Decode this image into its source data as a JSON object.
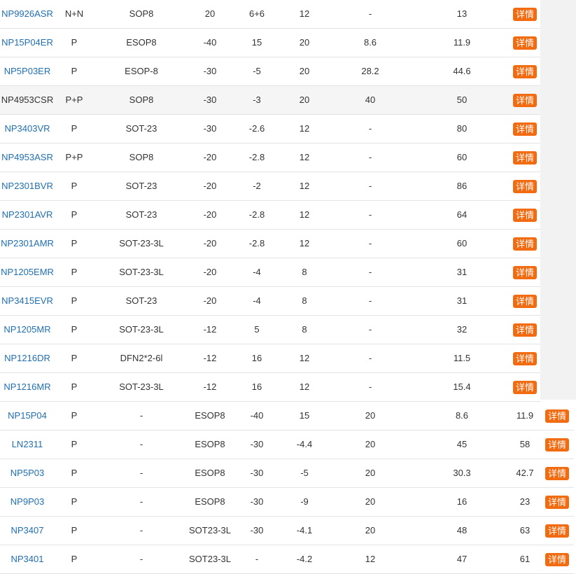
{
  "colors": {
    "accent": "#f26b10",
    "link": "#1f6fb2",
    "row_highlight": "#f5f5f5",
    "divider": "#e3e3e3"
  },
  "detail_label": "详情",
  "table_a": [
    {
      "model": "NP9926ASR",
      "polarity": "N+N",
      "package": "SOP8",
      "vds": "20",
      "id": "6+6",
      "vgs": "12",
      "rds10": "-",
      "rds45": "13",
      "link": true
    },
    {
      "model": "NP15P04ER",
      "polarity": "P",
      "package": "ESOP8",
      "vds": "-40",
      "id": "15",
      "vgs": "20",
      "rds10": "8.6",
      "rds45": "11.9",
      "link": true
    },
    {
      "model": "NP5P03ER",
      "polarity": "P",
      "package": "ESOP-8",
      "vds": "-30",
      "id": "-5",
      "vgs": "20",
      "rds10": "28.2",
      "rds45": "44.6",
      "link": true
    },
    {
      "model": "NP4953CSR",
      "polarity": "P+P",
      "package": "SOP8",
      "vds": "-30",
      "id": "-3",
      "vgs": "20",
      "rds10": "40",
      "rds45": "50",
      "link": false
    },
    {
      "model": "NP3403VR",
      "polarity": "P",
      "package": "SOT-23",
      "vds": "-30",
      "id": "-2.6",
      "vgs": "12",
      "rds10": "-",
      "rds45": "80",
      "link": true
    },
    {
      "model": "NP4953ASR",
      "polarity": "P+P",
      "package": "SOP8",
      "vds": "-20",
      "id": "-2.8",
      "vgs": "12",
      "rds10": "-",
      "rds45": "60",
      "link": true
    },
    {
      "model": "NP2301BVR",
      "polarity": "P",
      "package": "SOT-23",
      "vds": "-20",
      "id": "-2",
      "vgs": "12",
      "rds10": "-",
      "rds45": "86",
      "link": true
    },
    {
      "model": "NP2301AVR",
      "polarity": "P",
      "package": "SOT-23",
      "vds": "-20",
      "id": "-2.8",
      "vgs": "12",
      "rds10": "-",
      "rds45": "64",
      "link": true
    },
    {
      "model": "NP2301AMR",
      "polarity": "P",
      "package": "SOT-23-3L",
      "vds": "-20",
      "id": "-2.8",
      "vgs": "12",
      "rds10": "-",
      "rds45": "60",
      "link": true
    },
    {
      "model": "NP1205EMR",
      "polarity": "P",
      "package": "SOT-23-3L",
      "vds": "-20",
      "id": "-4",
      "vgs": "8",
      "rds10": "-",
      "rds45": "31",
      "link": true
    },
    {
      "model": "NP3415EVR",
      "polarity": "P",
      "package": "SOT-23",
      "vds": "-20",
      "id": "-4",
      "vgs": "8",
      "rds10": "-",
      "rds45": "31",
      "link": true
    },
    {
      "model": "NP1205MR",
      "polarity": "P",
      "package": "SOT-23-3L",
      "vds": "-12",
      "id": "5",
      "vgs": "8",
      "rds10": "-",
      "rds45": "32",
      "link": true
    },
    {
      "model": "NP1216DR",
      "polarity": "P",
      "package": "DFN2*2-6l",
      "vds": "-12",
      "id": "16",
      "vgs": "12",
      "rds10": "-",
      "rds45": "11.5",
      "link": true
    },
    {
      "model": "NP1216MR",
      "polarity": "P",
      "package": "SOT-23-3L",
      "vds": "-12",
      "id": "16",
      "vgs": "12",
      "rds10": "-",
      "rds45": "15.4",
      "link": true
    }
  ],
  "table_b": [
    {
      "model": "NP15P04",
      "polarity": "P",
      "col3": "-",
      "package": "ESOP8",
      "vds": "-40",
      "id": "15",
      "vgs": "20",
      "rds10": "8.6",
      "rds45": "11.9"
    },
    {
      "model": "LN2311",
      "polarity": "P",
      "col3": "-",
      "package": "ESOP8",
      "vds": "-30",
      "id": "-4.4",
      "vgs": "20",
      "rds10": "45",
      "rds45": "58"
    },
    {
      "model": "NP5P03",
      "polarity": "P",
      "col3": "-",
      "package": "ESOP8",
      "vds": "-30",
      "id": "-5",
      "vgs": "20",
      "rds10": "30.3",
      "rds45": "42.7"
    },
    {
      "model": "NP9P03",
      "polarity": "P",
      "col3": "-",
      "package": "ESOP8",
      "vds": "-30",
      "id": "-9",
      "vgs": "20",
      "rds10": "16",
      "rds45": "23"
    },
    {
      "model": "NP3407",
      "polarity": "P",
      "col3": "-",
      "package": "SOT23-3L",
      "vds": "-30",
      "id": "-4.1",
      "vgs": "20",
      "rds10": "48",
      "rds45": "63"
    },
    {
      "model": "NP3401",
      "polarity": "P",
      "col3": "-",
      "package": "SOT23-3L",
      "vds": "-",
      "id": "-4.2",
      "vgs": "12",
      "rds10": "47",
      "rds45": "61"
    }
  ]
}
